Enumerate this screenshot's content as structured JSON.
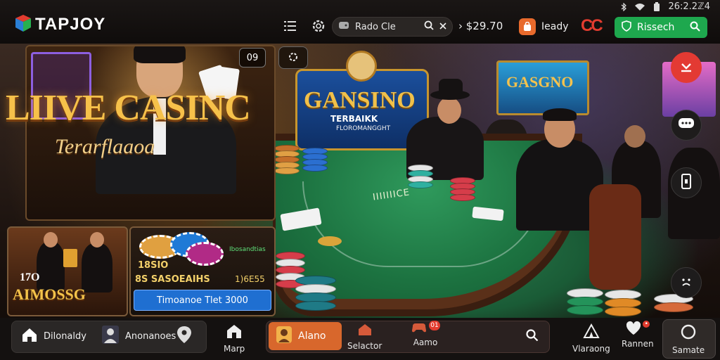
{
  "status_bar": {
    "time": "26:2.2ℤ4"
  },
  "topbar": {
    "logo": "TAPJOY",
    "search": {
      "value": "Rado Cle"
    },
    "balance": "› $29.70",
    "ready_label": "Ieady",
    "cc_label": "CC",
    "action_button": "Rissech"
  },
  "hero": {
    "live_card": {
      "title": "LIIVE CASINC",
      "subtitle": "Terarflaaoa",
      "badge": "09"
    },
    "sign": {
      "title": "GANSINO",
      "subtitle": "TERBAIKK",
      "subtitle2": "FLOROMANGGHT"
    },
    "neon_right": "GASGNO",
    "felt_text": "IIIIIIICE",
    "card_a": {
      "number": "17O",
      "title": "AIMOSSG"
    },
    "card_b": {
      "tag": "Ibosandtias",
      "line1": "18SIO",
      "line2": "8S SASOEAIHS",
      "line2_right": "1)6E55",
      "button": "Timoanoe Tlet 3000"
    }
  },
  "bottom_nav": {
    "left_group": [
      {
        "icon": "home-icon",
        "label": "Dilonaldy"
      },
      {
        "icon": "user-icon",
        "label": "Anonanoes"
      }
    ],
    "map": "Marp",
    "pill_items": [
      {
        "label": "Alano",
        "active": true
      },
      {
        "label": "Selactor"
      },
      {
        "label": "Aamo",
        "badge": "01"
      }
    ],
    "right_items": [
      {
        "label": "Vlaraong"
      },
      {
        "label": "Rannen",
        "badge": "•"
      },
      {
        "label": "Samate"
      }
    ]
  },
  "colors": {
    "accent_orange": "#d8672c",
    "accent_green": "#1ea84e",
    "accent_red": "#e23c2f"
  }
}
